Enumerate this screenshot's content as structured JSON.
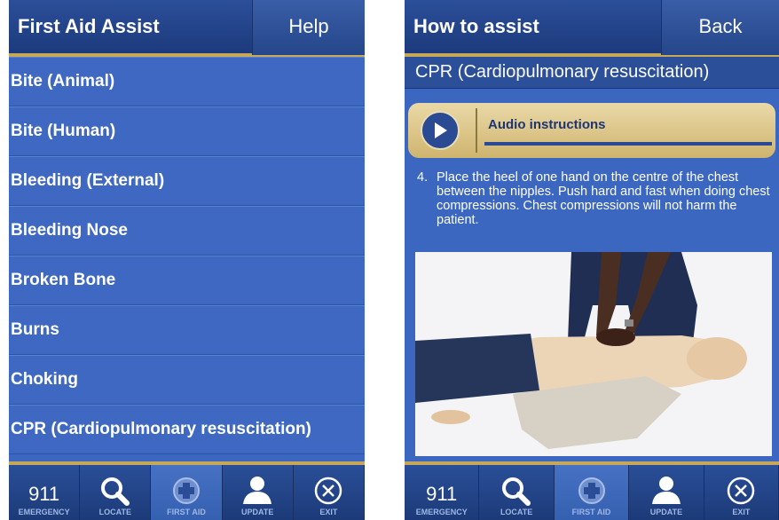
{
  "left": {
    "title": "First Aid Assist",
    "help_label": "Help",
    "menu": [
      {
        "label": "Bite (Animal)"
      },
      {
        "label": "Bite (Human)"
      },
      {
        "label": "Bleeding (External)"
      },
      {
        "label": "Bleeding Nose"
      },
      {
        "label": "Broken Bone"
      },
      {
        "label": "Burns"
      },
      {
        "label": "Choking"
      },
      {
        "label": "CPR (Cardiopulmonary resuscitation)"
      }
    ]
  },
  "right": {
    "title": "How to assist",
    "back_label": "Back",
    "subtitle": "CPR (Cardiopulmonary resuscitation)",
    "audio_label": "Audio instructions",
    "step_number": "4.",
    "step_text": "Place the heel of one hand on the centre of the chest  between the nipples. Push hard and fast when doing  chest compressions. Chest compressions will not harm  the patient."
  },
  "tabs": [
    {
      "label": "EMERGENCY",
      "number": "911",
      "icon": "phone-number"
    },
    {
      "label": "LOCATE",
      "icon": "magnifier-icon"
    },
    {
      "label": "FIRST AID",
      "icon": "plus-circle-icon"
    },
    {
      "label": "UPDATE",
      "icon": "person-icon"
    },
    {
      "label": "EXIT",
      "icon": "x-circle-icon"
    }
  ],
  "colors": {
    "header": "#1c3a7c",
    "list": "#3e68c1",
    "accent_gold": "#c6a85a"
  }
}
